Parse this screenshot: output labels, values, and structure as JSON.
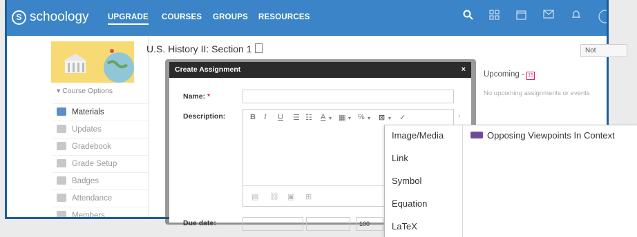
{
  "header": {
    "logo": "schoology",
    "logo_glyph": "S",
    "nav": {
      "upgrade": "UPGRADE",
      "courses": "COURSES",
      "groups": "GROUPS",
      "resources": "RESOURCES"
    },
    "icons": [
      "search-icon",
      "apps-grid-icon",
      "calendar-icon",
      "mail-icon",
      "notifications-icon"
    ]
  },
  "sidebar": {
    "course_options": "Course Options",
    "items": [
      {
        "label": "Materials",
        "active": true
      },
      {
        "label": "Updates"
      },
      {
        "label": "Gradebook"
      },
      {
        "label": "Grade Setup"
      },
      {
        "label": "Badges"
      },
      {
        "label": "Attendance"
      },
      {
        "label": "Members"
      }
    ]
  },
  "main": {
    "title": "U.S. History II: Section 1",
    "notify_button": "Not",
    "upcoming_title": "Upcoming -",
    "upcoming_calendar_glyph": "15",
    "upcoming_empty": "No upcoming assignments or events"
  },
  "modal": {
    "title": "Create Assignment",
    "close": "×",
    "name_label": "Name:",
    "required_mark": "*",
    "description_label": "Description:",
    "due_label": "Due date:",
    "due_time_value": "100"
  },
  "insert_menu": {
    "items": [
      "Image/Media",
      "Link",
      "Symbol",
      "Equation",
      "LaTeX"
    ],
    "submenu_item": "Opposing Viewpoints In Context"
  },
  "colors": {
    "brand": "#3b84c7",
    "frame": "#1a5d9e",
    "modal_header": "#2b2b2b"
  }
}
